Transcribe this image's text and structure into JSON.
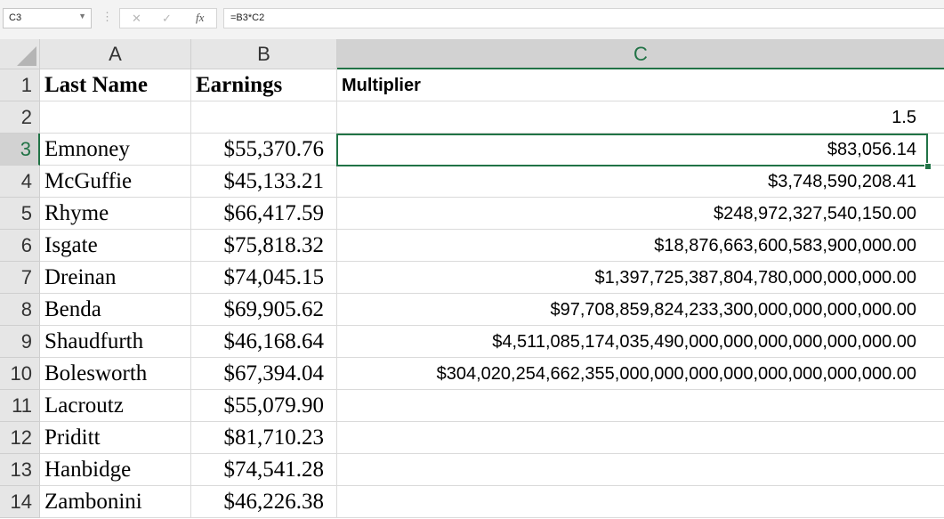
{
  "formula_bar": {
    "name_box": "C3",
    "dots": "⋮",
    "cancel_icon": "✕",
    "enter_icon": "✓",
    "fx_label": "fx",
    "formula": "=B3*C2"
  },
  "columns": [
    "A",
    "B",
    "C"
  ],
  "selected_column": "C",
  "selected_row": "3",
  "rows": [
    {
      "num": "1",
      "a": "Last Name",
      "b": "Earnings",
      "c": "Multiplier"
    },
    {
      "num": "2",
      "a": "",
      "b": "",
      "c": "1.5"
    },
    {
      "num": "3",
      "a": "Emnoney",
      "b": "$55,370.76",
      "c": "$83,056.14"
    },
    {
      "num": "4",
      "a": "McGuffie",
      "b": "$45,133.21",
      "c": "$3,748,590,208.41"
    },
    {
      "num": "5",
      "a": "Rhyme",
      "b": "$66,417.59",
      "c": "$248,972,327,540,150.00"
    },
    {
      "num": "6",
      "a": "Isgate",
      "b": "$75,818.32",
      "c": "$18,876,663,600,583,900,000.00"
    },
    {
      "num": "7",
      "a": "Dreinan",
      "b": "$74,045.15",
      "c": "$1,397,725,387,804,780,000,000,000.00"
    },
    {
      "num": "8",
      "a": "Benda",
      "b": "$69,905.62",
      "c": "$97,708,859,824,233,300,000,000,000,000.00"
    },
    {
      "num": "9",
      "a": "Shaudfurth",
      "b": "$46,168.64",
      "c": "$4,511,085,174,035,490,000,000,000,000,000,000.00"
    },
    {
      "num": "10",
      "a": "Bolesworth",
      "b": "$67,394.04",
      "c": "$304,020,254,662,355,000,000,000,000,000,000,000,000.00"
    },
    {
      "num": "11",
      "a": "Lacroutz",
      "b": "$55,079.90",
      "c": ""
    },
    {
      "num": "12",
      "a": "Priditt",
      "b": "$81,710.23",
      "c": ""
    },
    {
      "num": "13",
      "a": "Hanbidge",
      "b": "$74,541.28",
      "c": ""
    },
    {
      "num": "14",
      "a": "Zambonini",
      "b": "$46,226.38",
      "c": ""
    }
  ]
}
